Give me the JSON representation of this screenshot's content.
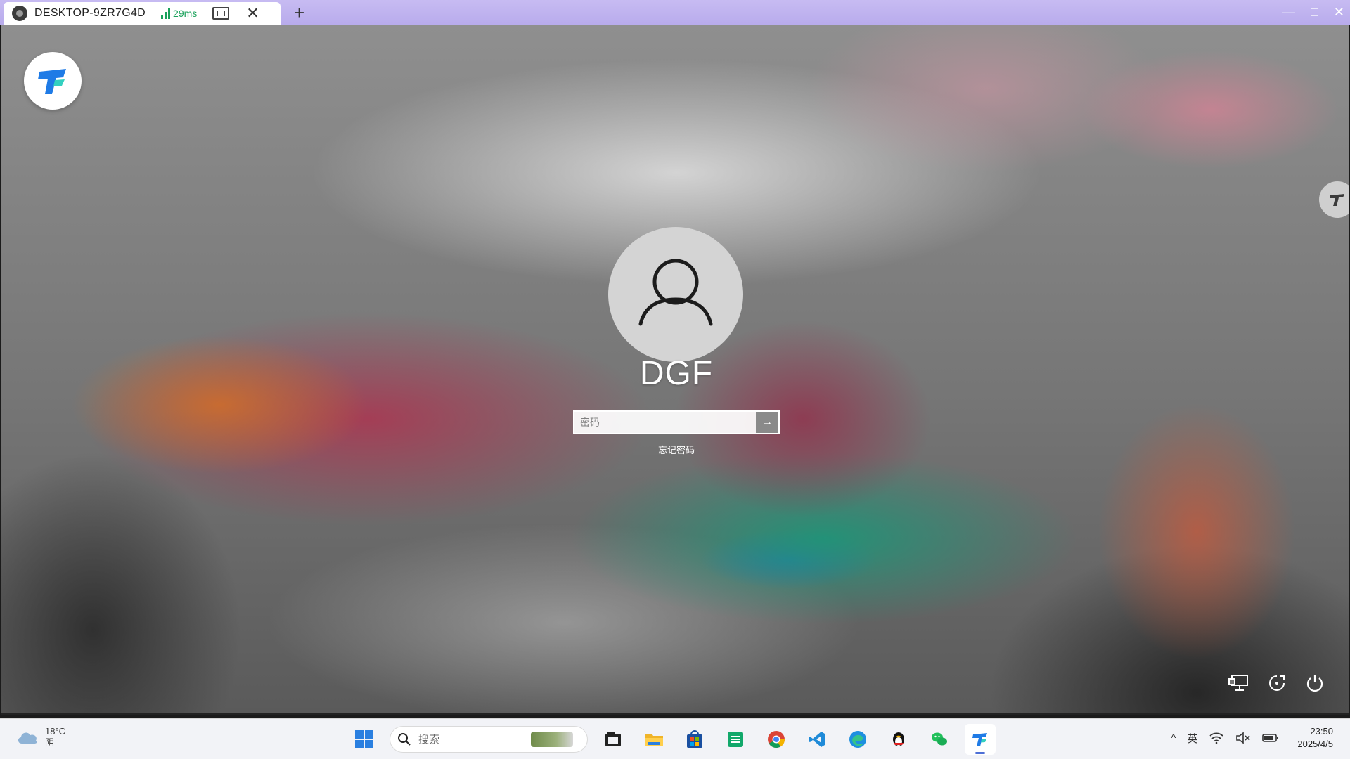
{
  "session_tab": {
    "title": "DESKTOP-9ZR7G4D",
    "latency": "29ms",
    "close_glyph": "✕",
    "new_tab_glyph": "+"
  },
  "window_controls": {
    "minimize": "—",
    "maximize": "□",
    "close": "✕"
  },
  "lock_screen": {
    "username": "DGF",
    "password_placeholder": "密码",
    "submit_glyph": "→",
    "forgot_password": "忘记密码"
  },
  "lock_tools": [
    {
      "icon": "network-icon",
      "label": "network"
    },
    {
      "icon": "accessibility-icon",
      "label": "accessibility"
    },
    {
      "icon": "power-icon",
      "label": "power"
    }
  ],
  "taskbar": {
    "weather": {
      "temperature": "18°C",
      "condition": "阴"
    },
    "search_placeholder": "搜索",
    "apps": [
      "start-menu",
      "file-manager",
      "file-explorer",
      "microsoft-store",
      "sheets-app",
      "chrome",
      "vscode",
      "edge",
      "qq",
      "wechat",
      "todesk"
    ],
    "tray": {
      "overflow": "^",
      "ime": "英",
      "date": "2025/4/5",
      "time": "23:50"
    }
  },
  "colors": {
    "tab_strip": "#c7bbf2",
    "latency_green": "#19a15a",
    "todesk_blue": "#1f7be6",
    "taskbar": "#f2f3f7"
  }
}
